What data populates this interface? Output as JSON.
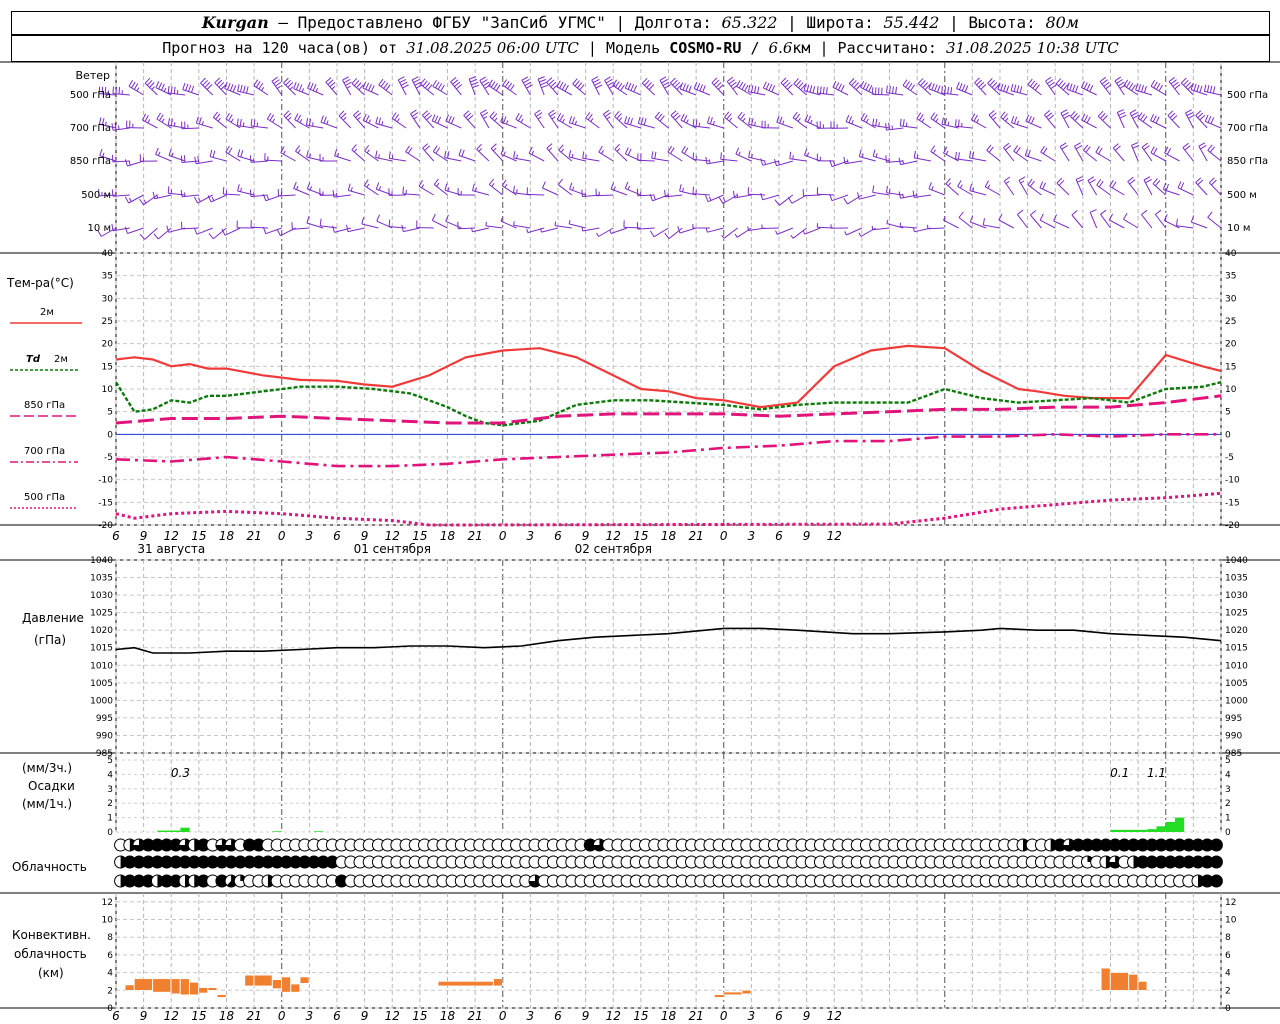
{
  "header": {
    "station": "Kurgan",
    "provider": "— Предоставлено ФГБУ \"ЗапСиб УГМС\" | Долгота:",
    "lon": "65.322",
    "lat_label": "| Широта:",
    "lat": "55.442",
    "alt_label": "| Высота:",
    "alt": "80м",
    "forecast_label": "Прогноз на 120 часа(ов) от",
    "forecast_start": "31.08.2025 06:00 UTC",
    "model_label": "| Модель",
    "model": "COSMO-RU",
    "res_sep": "/",
    "res_value": "6.6",
    "res_unit": "км",
    "calc_label": "| Рассчитано:",
    "calc_time": "31.08.2025 10:38 UTC"
  },
  "labels": {
    "wind": "Ветер",
    "levels": [
      "500 гПа",
      "700 гПа",
      "850 гПа",
      "500 м",
      "10 м"
    ],
    "temp": "Тем-ра(°С)",
    "t2m": "2м",
    "td_sym": "Td",
    "td_lvl": "2м",
    "t850": "850 гПа",
    "t700": "700 гПа",
    "t500": "500 гПа",
    "pressure": "Давление",
    "pressure_unit": "(гПа)",
    "precip_unit1": "(мм/3ч.)",
    "precip": "Осадки",
    "precip_unit2": "(мм/1ч.)",
    "cloud": "Облачность",
    "conv1": "Конвективн.",
    "conv2": "облачность",
    "conv3": "(км)"
  },
  "colors": {
    "wind": "#7a2cc8",
    "t2m": "#f03a3a",
    "td": "#0a7a0a",
    "level_temp": "#e0147a",
    "zero": "#1a3ad8",
    "precip": "#22dd22",
    "conv": "#f08030",
    "pressure": "#000000"
  },
  "chart_data": [
    {
      "type": "line",
      "title": "Тем-ра(°С)",
      "x_unit": "hours from 31.08.2025 06:00 UTC",
      "x_ticks": [
        "6",
        "9",
        "12",
        "15",
        "18",
        "21",
        "0",
        "3",
        "6",
        "9",
        "12",
        "15",
        "18",
        "21",
        "0",
        "3",
        "6",
        "9",
        "12",
        "15",
        "18",
        "21",
        "0",
        "3",
        "6",
        "9",
        "12"
      ],
      "day_labels": [
        {
          "hour": 6,
          "text": "31 августа"
        },
        {
          "hour": 30,
          "text": "01 сентября"
        },
        {
          "hour": 54,
          "text": "02 сентября"
        }
      ],
      "ylim": [
        -20,
        40
      ],
      "y_ticks": [
        40,
        35,
        30,
        25,
        20,
        15,
        10,
        5,
        0,
        -5,
        -10,
        -15,
        -20
      ],
      "series": [
        {
          "name": "2м",
          "x": [
            0,
            2,
            4,
            6,
            8,
            10,
            12,
            16,
            20,
            24,
            27,
            30,
            34,
            38,
            42,
            46,
            50,
            54,
            57,
            60,
            63,
            66,
            70,
            74,
            78,
            82,
            86,
            90,
            94,
            98,
            100,
            103,
            106,
            110,
            114,
            118,
            120
          ],
          "values": [
            16.5,
            17,
            16.5,
            15,
            15.5,
            14.5,
            14.5,
            13,
            12,
            11.8,
            11,
            10.5,
            13,
            17,
            18.5,
            19,
            17,
            13,
            10,
            9.5,
            8,
            7.5,
            6,
            7,
            15,
            18.5,
            19.5,
            19,
            14,
            10,
            9.5,
            8.5,
            8,
            8,
            17.5,
            15,
            14
          ]
        },
        {
          "name": "Td 2м",
          "x": [
            0,
            2,
            4,
            6,
            8,
            10,
            12,
            16,
            20,
            24,
            28,
            32,
            36,
            38,
            40,
            42,
            44,
            46,
            50,
            54,
            58,
            62,
            66,
            70,
            72,
            74,
            78,
            82,
            86,
            90,
            94,
            98,
            102,
            106,
            110,
            114,
            118,
            120
          ],
          "values": [
            11.5,
            5,
            5.5,
            7.5,
            7,
            8.5,
            8.5,
            9.5,
            10.5,
            10.5,
            10,
            9,
            6,
            4,
            2.5,
            2,
            2.5,
            3,
            6.5,
            7.5,
            7.5,
            7,
            6.5,
            5.5,
            6,
            6.5,
            7,
            7,
            7,
            10,
            8,
            7,
            7.5,
            8,
            7,
            10,
            10.5,
            11.5
          ]
        },
        {
          "name": "850 гПа",
          "x": [
            0,
            6,
            12,
            18,
            24,
            30,
            36,
            42,
            48,
            54,
            60,
            66,
            72,
            78,
            84,
            90,
            96,
            102,
            108,
            114,
            120
          ],
          "values": [
            2.5,
            3.5,
            3.5,
            4,
            3.5,
            3,
            2.5,
            2.5,
            4,
            4.5,
            4.5,
            4.5,
            4,
            4.5,
            5,
            5.5,
            5.5,
            6,
            6,
            7,
            8.5
          ]
        },
        {
          "name": "700 гПа",
          "x": [
            0,
            6,
            12,
            18,
            24,
            30,
            36,
            42,
            48,
            54,
            60,
            66,
            72,
            78,
            84,
            90,
            96,
            102,
            108,
            114,
            120
          ],
          "values": [
            -5.5,
            -6,
            -5,
            -6,
            -7,
            -7,
            -6.5,
            -5.5,
            -5,
            -4.5,
            -4,
            -3,
            -2.5,
            -1.5,
            -1.5,
            -0.5,
            -0.5,
            0,
            -0.5,
            0,
            0
          ]
        },
        {
          "name": "500 гПа",
          "x": [
            0,
            2,
            6,
            12,
            18,
            24,
            30,
            34,
            36,
            84,
            90,
            96,
            102,
            108,
            114,
            120
          ],
          "values": [
            -17.5,
            -18.5,
            -17.5,
            -17,
            -17.5,
            -18.5,
            -19,
            -20,
            -20.5,
            -19.8,
            -18.5,
            -16.5,
            -15.5,
            -14.5,
            -14,
            -13
          ]
        }
      ]
    },
    {
      "type": "line",
      "title": "Давление",
      "ylabel": "(гПа)",
      "ylim": [
        985,
        1040
      ],
      "y_ticks": [
        1040,
        1035,
        1030,
        1025,
        1020,
        1015,
        1010,
        1005,
        1000,
        995,
        990,
        985
      ],
      "series": [
        {
          "name": "Давление",
          "x": [
            0,
            2,
            4,
            6,
            8,
            12,
            16,
            20,
            24,
            28,
            32,
            36,
            40,
            44,
            48,
            52,
            56,
            60,
            64,
            66,
            70,
            74,
            80,
            84,
            90,
            94,
            96,
            100,
            104,
            108,
            112,
            116,
            120
          ],
          "values": [
            1014.5,
            1015,
            1013.5,
            1013.5,
            1013.5,
            1014,
            1014,
            1014.5,
            1015,
            1015,
            1015.5,
            1015.5,
            1015,
            1015.5,
            1017,
            1018,
            1018.5,
            1019,
            1020,
            1020.5,
            1020.5,
            1020,
            1019,
            1019,
            1019.5,
            1020,
            1020.5,
            1020,
            1020,
            1019,
            1018.5,
            1018,
            1017
          ]
        }
      ]
    },
    {
      "type": "bar",
      "title": "Осадки",
      "ylabel": "(мм/3ч.) (мм/1ч.)",
      "ylim": [
        0,
        5
      ],
      "y_ticks": [
        5,
        4,
        3,
        2,
        1,
        0
      ],
      "annotations": [
        {
          "x": 7,
          "text": "0.3"
        },
        {
          "x": 109,
          "text": "0.1"
        },
        {
          "x": 113,
          "text": "1.1"
        }
      ],
      "bars": [
        {
          "x0": 4.5,
          "x1": 7,
          "value": 0.1
        },
        {
          "x0": 7,
          "x1": 8,
          "value": 0.3
        },
        {
          "x0": 17,
          "x1": 18,
          "value": 0.05
        },
        {
          "x0": 21.5,
          "x1": 22.5,
          "value": 0.05
        },
        {
          "x0": 108,
          "x1": 112,
          "value": 0.15
        },
        {
          "x0": 112,
          "x1": 113,
          "value": 0.2
        },
        {
          "x0": 113,
          "x1": 114,
          "value": 0.4
        },
        {
          "x0": 114,
          "x1": 115,
          "value": 0.7
        },
        {
          "x0": 115,
          "x1": 116,
          "value": 1.0
        }
      ]
    },
    {
      "type": "table",
      "title": "Облачность",
      "note": "cloud cover in octas per hour, rows: upper/middle/lower layer",
      "rows": [
        "0468888648066088000000000000000000000000000000000008600000000000000000000000000000000000000000000040048688888888888888888888",
        "4888888888888888888888880000000000000000000000000000000000000000000000000000000000000000000000000000000002046048888888888888888",
        "4888488448085200400000008000000000000000000006000000000000000000000000000000000000000000000000000000000000000000000004888888888"
      ]
    },
    {
      "type": "bar",
      "title": "Конвективн. облачность (км)",
      "ylim": [
        0,
        13
      ],
      "y_ticks": [
        12,
        10,
        8,
        6,
        4,
        2,
        0
      ],
      "bars": [
        {
          "x0": 1,
          "x1": 2,
          "base": 2,
          "top": 2.6
        },
        {
          "x0": 2,
          "x1": 4,
          "base": 2,
          "top": 3.3
        },
        {
          "x0": 4,
          "x1": 6,
          "base": 1.8,
          "top": 3.3
        },
        {
          "x0": 6,
          "x1": 7,
          "base": 1.6,
          "top": 3.3
        },
        {
          "x0": 7,
          "x1": 8,
          "base": 1.5,
          "top": 3.3
        },
        {
          "x0": 8,
          "x1": 9,
          "base": 1.5,
          "top": 2.9
        },
        {
          "x0": 9,
          "x1": 10,
          "base": 1.7,
          "top": 2.3
        },
        {
          "x0": 10,
          "x1": 11,
          "base": 2,
          "top": 2.3
        },
        {
          "x0": 11,
          "x1": 12,
          "base": 1.2,
          "top": 1.5
        },
        {
          "x0": 14,
          "x1": 15,
          "base": 2.5,
          "top": 3.7
        },
        {
          "x0": 15,
          "x1": 17,
          "base": 2.5,
          "top": 3.7
        },
        {
          "x0": 17,
          "x1": 18,
          "base": 2.2,
          "top": 3.2
        },
        {
          "x0": 18,
          "x1": 19,
          "base": 1.8,
          "top": 3.5
        },
        {
          "x0": 19,
          "x1": 20,
          "base": 1.8,
          "top": 2.7
        },
        {
          "x0": 20,
          "x1": 21,
          "base": 2.8,
          "top": 3.5
        },
        {
          "x0": 35,
          "x1": 41,
          "base": 2.5,
          "top": 3.0
        },
        {
          "x0": 41,
          "x1": 42,
          "base": 2.5,
          "top": 3.3
        },
        {
          "x0": 65,
          "x1": 66,
          "base": 1.2,
          "top": 1.5
        },
        {
          "x0": 66,
          "x1": 68,
          "base": 1.5,
          "top": 1.8
        },
        {
          "x0": 68,
          "x1": 69,
          "base": 1.6,
          "top": 2.0
        },
        {
          "x0": 107,
          "x1": 108,
          "base": 2.0,
          "top": 4.5
        },
        {
          "x0": 108,
          "x1": 110,
          "base": 2.0,
          "top": 4.0
        },
        {
          "x0": 110,
          "x1": 111,
          "base": 2.0,
          "top": 3.8
        },
        {
          "x0": 111,
          "x1": 112,
          "base": 2.0,
          "top": 3.0
        }
      ]
    },
    {
      "type": "scatter",
      "title": "Ветер",
      "note": "wind barbs at 10 м, 500 м, 850 гПа, 700 гПа, 500 гПа (direction in degrees, speed in m/s)",
      "levels": [
        "10 м",
        "500 м",
        "850 гПа",
        "700 гПа",
        "500 гПа"
      ],
      "x": [
        0,
        12,
        24,
        36,
        48,
        60,
        72,
        84,
        96,
        108,
        120
      ],
      "dir": {
        "10 м": [
          240,
          250,
          270,
          280,
          270,
          250,
          250,
          260,
          300,
          320,
          290
        ],
        "500 м": [
          250,
          260,
          280,
          290,
          290,
          270,
          250,
          260,
          310,
          320,
          300
        ],
        "850 гПа": [
          270,
          280,
          290,
          300,
          300,
          290,
          270,
          270,
          300,
          320,
          310
        ],
        "700 гПа": [
          280,
          290,
          300,
          310,
          310,
          300,
          290,
          280,
          300,
          320,
          310
        ],
        "500 гПа": [
          290,
          300,
          310,
          320,
          320,
          310,
          300,
          290,
          300,
          310,
          300
        ]
      },
      "speed": {
        "10 м": [
          4,
          5,
          4,
          4,
          3,
          4,
          3,
          3,
          4,
          6,
          5
        ],
        "500 м": [
          7,
          8,
          7,
          7,
          6,
          7,
          6,
          6,
          8,
          10,
          9
        ],
        "850 гПа": [
          8,
          9,
          8,
          9,
          8,
          9,
          8,
          8,
          9,
          11,
          10
        ],
        "700 гПа": [
          12,
          13,
          12,
          14,
          13,
          14,
          12,
          12,
          13,
          15,
          14
        ],
        "500 гПа": [
          18,
          19,
          18,
          22,
          24,
          22,
          20,
          20,
          22,
          24,
          22
        ]
      }
    }
  ]
}
